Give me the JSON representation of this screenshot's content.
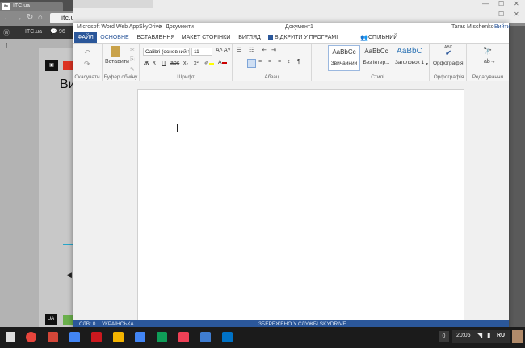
{
  "bg_browser": {
    "tab1_title": "ITC.ua",
    "url": "itc.u",
    "admin_site": "ITC.ua",
    "admin_comments": "96",
    "sidebar_bullet": "†",
    "content_heading": "Ви",
    "footer_label": "UA"
  },
  "window": {
    "app_title": "Microsoft Word Web App",
    "breadcrumb_1": "SkyDrive",
    "breadcrumb_sep": ">",
    "breadcrumb_2": "Документи",
    "doc_name": "Документ1",
    "user": "Taras Mischenko",
    "signout": "Вийти",
    "controls": {
      "min": "—",
      "max": "☐",
      "close": "✕"
    }
  },
  "ribbon_tabs": {
    "file": "ФАЙЛ",
    "home": "ОСНОВНЕ",
    "insert": "ВСТАВЛЕННЯ",
    "layout": "МАКЕТ СТОРІНКИ",
    "view": "ВИГЛЯД",
    "open_in_word": "ВІДКРИТИ У ПРОГРАМІ WORD",
    "share": "СПІЛЬНИЙ ДОСТУП"
  },
  "ribbon": {
    "undo_group": "Скасувати",
    "paste_label": "Вставити",
    "clipboard_group": "Буфер обміну",
    "font_name": "Calibri (основний т",
    "font_size": "11",
    "font_group": "Шрифт",
    "paragraph_group": "Абзац",
    "styles": [
      {
        "sample": "AaBbCc",
        "name": "Звичайний"
      },
      {
        "sample": "AaBbCc",
        "name": "Без інтер..."
      },
      {
        "sample": "AaBbC",
        "name": "Заголовок 1"
      }
    ],
    "styles_group": "Стилі",
    "spelling_label": "Орфографія",
    "spelling_group": "Орфографія",
    "editing_group": "Редагування",
    "bold": "Ж",
    "italic": "К",
    "underline": "П",
    "strike": "abc",
    "subscript": "x₂",
    "superscript": "x²"
  },
  "status": {
    "words": "СЛВ: 0",
    "language": "УКРАЇНСЬКА",
    "saved": "ЗБЕРЕЖЕНО У СЛУЖБІ SKYDRIVE"
  },
  "taskbar": {
    "badge": "0",
    "time": "20:05",
    "lang": "RU",
    "colors": {
      "chrome": "#e8453c",
      "gmail": "#d44638",
      "docs": "#4285f4",
      "drive": "#0f9d58",
      "youtube": "#cc181e",
      "pocket": "#ef4056",
      "skydrive": "#0072c6"
    }
  }
}
